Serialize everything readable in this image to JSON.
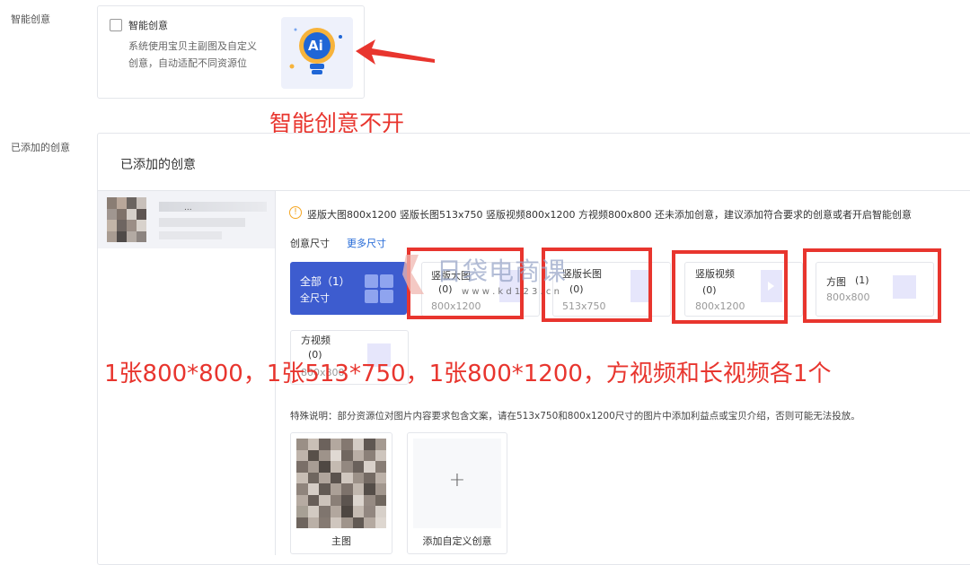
{
  "labels": {
    "smart_section": "智能创意",
    "added_section": "已添加的创意"
  },
  "smart_card": {
    "checkbox_label": "智能创意",
    "desc_line1": "系统使用宝贝主副图及自定义",
    "desc_line2": "创意，自动适配不同资源位",
    "ai_text": "Ai"
  },
  "annotation_top": "智能创意不开",
  "added_panel": {
    "title": "已添加的创意",
    "warning": "竖版大图800x1200 竖版长图513x750 竖版视频800x1200 方视频800x800 还未添加创意，建议添加符合要求的创意或者开启智能创意",
    "size_label": "创意尺寸",
    "more_sizes": "更多尺寸",
    "all_card": {
      "title": "全部（1）",
      "sub": "全尺寸"
    },
    "size_cards": [
      {
        "name": "竖版大图",
        "count": "(0)",
        "size": "800x1200"
      },
      {
        "name": "竖版长图",
        "count": "(0)",
        "size": "513x750"
      },
      {
        "name": "竖版视频",
        "count": "(0)",
        "size": "800x1200"
      },
      {
        "name": "方图",
        "count": "(1)",
        "size": "800x800"
      },
      {
        "name": "方视频",
        "count": "(0)",
        "size": "800x800"
      }
    ],
    "annotation_bottom": "1张800*800，1张513*750，1张800*1200，方视频和长视频各1个",
    "note": "特殊说明：部分资源位对图片内容要求包含文案，请在513x750和800x1200尺寸的图片中添加利益点或宝贝介绍，否则可能无法投放。",
    "main_image_label": "主图",
    "add_custom_label": "添加自定义创意",
    "add_icon": "+",
    "item_dots": "..."
  },
  "watermark": {
    "text": "日袋电商课",
    "url": "w w w . k d 1 2 3 . c n"
  }
}
